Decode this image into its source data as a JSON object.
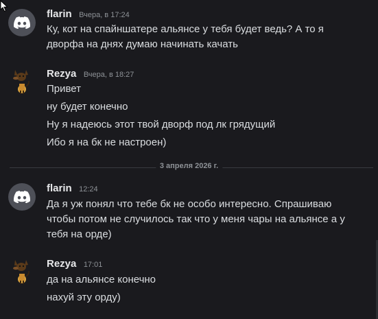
{
  "messages": [
    {
      "username": "flarin",
      "timestamp": "Вчера, в 17:24",
      "avatar_icon": "discord-logo-icon",
      "lines": [
        "Ку, кот на спайншатере альянсе у тебя будет ведь? А то я",
        "дворфа на днях думаю начинать качать"
      ]
    },
    {
      "username": "Rezya",
      "timestamp": "Вчера, в 18:27",
      "avatar_icon": "rezya-avatar-icon",
      "lines": [
        "Привет",
        "ну будет конечно",
        "Ну я надеюсь этот твой дворф под лк грядущий",
        "Ибо я на бк не настроен)"
      ]
    },
    {
      "username": "flarin",
      "timestamp": "12:24",
      "avatar_icon": "discord-logo-icon",
      "lines": [
        "Да я уж понял что тебе бк не особо интересно. Спрашиваю",
        "чтобы потом не случилось так что у меня чары на альянсе а у",
        "тебя на орде)"
      ]
    },
    {
      "username": "Rezya",
      "timestamp": "17:01",
      "avatar_icon": "rezya-avatar-icon",
      "lines": [
        "да на альянсе конечно",
        "нахуй эту орду)"
      ]
    }
  ],
  "date_divider": "3 апреля 2026 г.",
  "colors": {
    "background": "#1a1a1e",
    "text": "#dbdee1",
    "muted": "#8e9297",
    "discord_avatar_bg": "#4e5058"
  }
}
